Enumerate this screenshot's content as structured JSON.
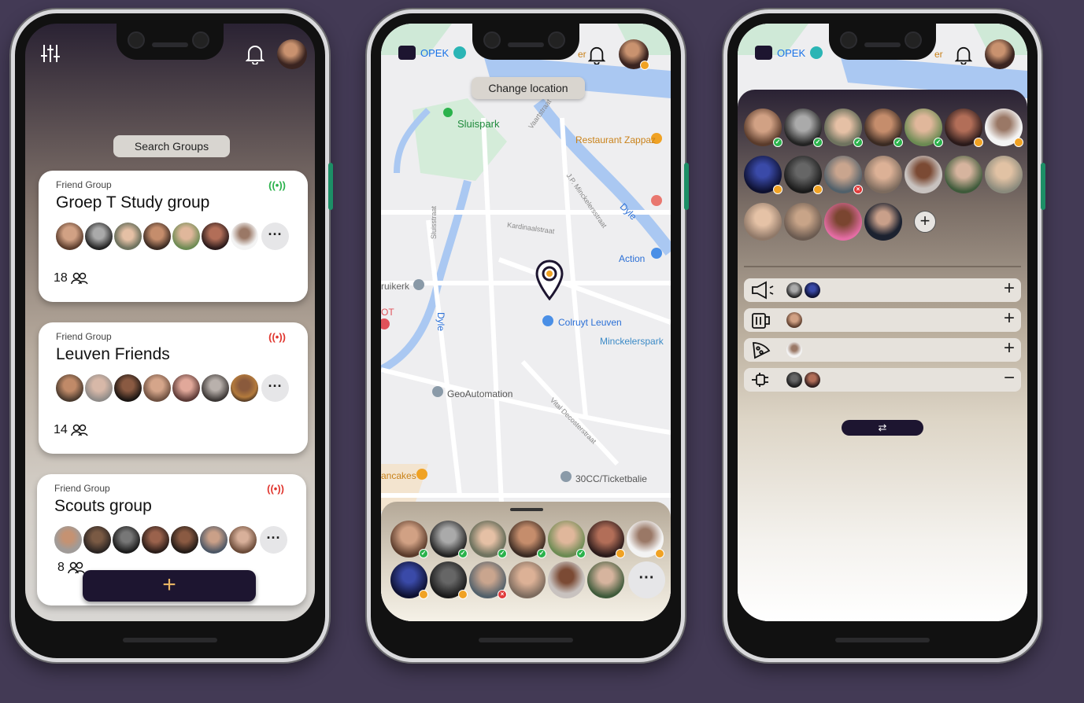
{
  "colors": {
    "background": "#433a55",
    "accent_dark": "#1d1530",
    "live_green": "#2bb24c",
    "live_red": "#e0362f",
    "plus_gold": "#e8b563"
  },
  "phone1": {
    "search_label": "Search Groups",
    "groups": [
      {
        "type": "Friend Group",
        "name": "Groep T Study group",
        "live_color": "#2bb24c",
        "count": "18",
        "live_icon": "broadcast-icon"
      },
      {
        "type": "Friend Group",
        "name": "Leuven Friends",
        "live_color": "#e0362f",
        "count": "14",
        "live_icon": "broadcast-icon"
      },
      {
        "type": "Friend Group",
        "name": "Scouts group",
        "live_color": "#e0362f",
        "count": "8",
        "live_icon": "broadcast-icon"
      }
    ],
    "more_label": "···",
    "add_label": "+"
  },
  "phone2": {
    "change_location": "Change location",
    "brand": "OPEK",
    "map_labels": {
      "sluispark": "Sluispark",
      "restaurant": "Restaurant Zappaz",
      "action": "Action",
      "colruyt": "Colruyt Leuven",
      "minckelerspark": "Minckelerspark",
      "geo": "GeoAutomation",
      "ticket": "30CC/Ticketbalie",
      "pancakes": "ancakes",
      "ruikerk": "ruikerk",
      "dyle": "Dyle",
      "dyle2": "Dyle",
      "ot": "OT",
      "er": "er",
      "vaart": "Vaartstraat",
      "minck_str": "J.P. Minckelersstraat",
      "kardinaal": "Kardinaalstraat",
      "sluisstraat": "Sluisstraat",
      "vital": "Vital Decosterstraat"
    },
    "more_label": "···"
  },
  "phone3": {
    "brand": "OPEK",
    "er": "er",
    "add_person": "+",
    "categories": [
      {
        "icon": "megaphone-icon",
        "action": "+"
      },
      {
        "icon": "beer-icon",
        "action": "+"
      },
      {
        "icon": "pizza-icon",
        "action": "+"
      },
      {
        "icon": "plug-icon",
        "action": "−"
      }
    ],
    "swap_label": "⇄"
  }
}
